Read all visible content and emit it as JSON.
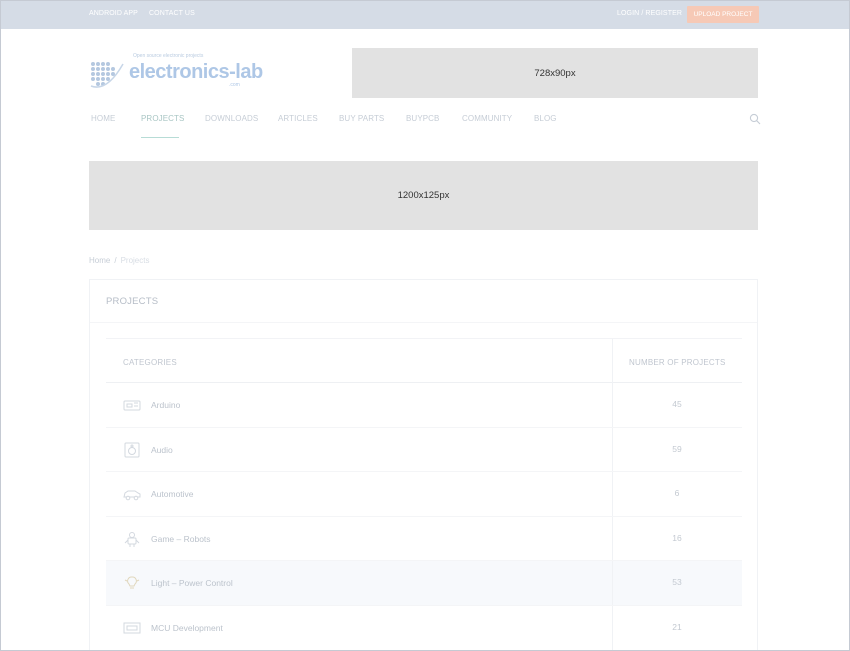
{
  "topbar": {
    "android_app": "ANDROID APP",
    "contact_us": "CONTACT US",
    "login_register": "LOGIN / REGISTER",
    "upload_project": "UPLOAD PROJECT"
  },
  "logo": {
    "tagline": "Open source electronic projects",
    "wordmark": "electronics-lab",
    "suffix": ".com"
  },
  "ads": {
    "top_banner": "728x90px",
    "wide_banner": "1200x125px"
  },
  "nav": {
    "items": [
      "HOME",
      "PROJECTS",
      "DOWNLOADS",
      "ARTICLES",
      "BUY PARTS",
      "BUYPCB",
      "COMMUNITY",
      "BLOG"
    ],
    "active": "PROJECTS",
    "search_icon": "search-icon"
  },
  "breadcrumb": {
    "home": "Home",
    "separator": "/",
    "current": "Projects"
  },
  "projects": {
    "title": "PROJECTS",
    "col_categories": "CATEGORIES",
    "col_count": "NUMBER OF PROJECTS",
    "rows": [
      {
        "name": "Arduino",
        "count": "45",
        "icon": "arduino-board-icon"
      },
      {
        "name": "Audio",
        "count": "59",
        "icon": "speaker-icon"
      },
      {
        "name": "Automotive",
        "count": "6",
        "icon": "car-icon"
      },
      {
        "name": "Game – Robots",
        "count": "16",
        "icon": "robot-icon"
      },
      {
        "name": "Light – Power Control",
        "count": "53",
        "icon": "light-bulb-icon"
      },
      {
        "name": "MCU Development",
        "count": "21",
        "icon": "chip-icon"
      }
    ]
  },
  "colors": {
    "topbar_bg": "#d5dce6",
    "upload_button": "#f6c9b6",
    "ad_placeholder": "#e2e2e2",
    "active_nav": "#a9c6c4"
  }
}
